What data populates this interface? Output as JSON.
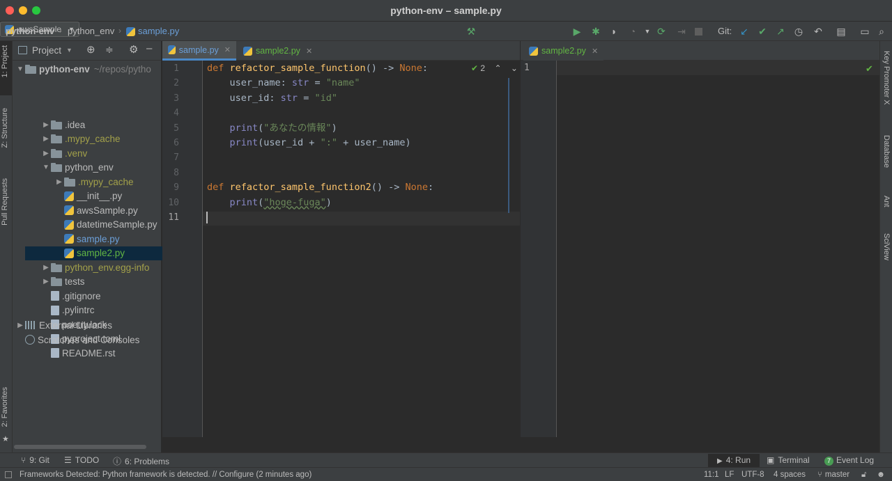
{
  "window": {
    "title": "python-env – sample.py"
  },
  "breadcrumb": [
    "python-env",
    "python_env",
    "sample.py"
  ],
  "toolbar": {
    "run_config": "awsSample",
    "git_label": "Git:"
  },
  "left_tabs": {
    "project": "1: Project",
    "structure": "Z: Structure",
    "pull_requests": "Pull Requests",
    "favorites": "2: Favorites"
  },
  "right_tabs": {
    "key_promoter": "Key Promoter X",
    "database": "Database",
    "ant": "Ant",
    "sciview": "SciView"
  },
  "project_panel": {
    "header": "Project",
    "root": {
      "name": "python-env",
      "path": "~/repos/pytho"
    },
    "items": [
      {
        "label": ".idea",
        "type": "folder",
        "depth": 1,
        "expand": "collapsed",
        "color": "default"
      },
      {
        "label": ".mypy_cache",
        "type": "folder",
        "depth": 1,
        "expand": "collapsed",
        "color": "olive"
      },
      {
        "label": ".venv",
        "type": "folder",
        "depth": 1,
        "expand": "collapsed",
        "color": "olive"
      },
      {
        "label": "python_env",
        "type": "folder",
        "depth": 1,
        "expand": "expanded",
        "color": "default"
      },
      {
        "label": ".mypy_cache",
        "type": "folder",
        "depth": 2,
        "expand": "collapsed",
        "color": "olive"
      },
      {
        "label": "__init__.py",
        "type": "py",
        "depth": 2,
        "expand": "none",
        "color": "default"
      },
      {
        "label": "awsSample.py",
        "type": "py",
        "depth": 2,
        "expand": "none",
        "color": "default"
      },
      {
        "label": "datetimeSample.py",
        "type": "py",
        "depth": 2,
        "expand": "none",
        "color": "default"
      },
      {
        "label": "sample.py",
        "type": "py",
        "depth": 2,
        "expand": "none",
        "color": "blue"
      },
      {
        "label": "sample2.py",
        "type": "py",
        "depth": 2,
        "expand": "none",
        "color": "green",
        "selected": true
      },
      {
        "label": "python_env.egg-info",
        "type": "folder",
        "depth": 1,
        "expand": "collapsed",
        "color": "olive"
      },
      {
        "label": "tests",
        "type": "folder",
        "depth": 1,
        "expand": "collapsed",
        "color": "default"
      },
      {
        "label": ".gitignore",
        "type": "file",
        "depth": 1,
        "expand": "none",
        "color": "default"
      },
      {
        "label": ".pylintrc",
        "type": "file",
        "depth": 1,
        "expand": "none",
        "color": "default"
      },
      {
        "label": "poetry.lock",
        "type": "file",
        "depth": 1,
        "expand": "none",
        "color": "default"
      },
      {
        "label": "pyproject.toml",
        "type": "file",
        "depth": 1,
        "expand": "none",
        "color": "default"
      },
      {
        "label": "README.rst",
        "type": "file",
        "depth": 1,
        "expand": "none",
        "color": "default"
      }
    ],
    "external_libraries": "External Libraries",
    "scratches": "Scratches and Consoles"
  },
  "editor_left": {
    "tabs": [
      {
        "label": "sample.py",
        "active": true
      },
      {
        "label": "sample2.py",
        "active": false
      }
    ],
    "inspection_count": "2",
    "line_numbers": [
      "1",
      "2",
      "3",
      "4",
      "5",
      "6",
      "7",
      "8",
      "9",
      "10",
      "11"
    ],
    "lines": [
      [
        {
          "t": "def ",
          "c": "kw"
        },
        {
          "t": "refactor_sample_function",
          "c": "fn"
        },
        {
          "t": "() -> ",
          "c": ""
        },
        {
          "t": "None",
          "c": "kw"
        },
        {
          "t": ":",
          "c": ""
        }
      ],
      [
        {
          "t": "    user_name: ",
          "c": ""
        },
        {
          "t": "str",
          "c": "bi"
        },
        {
          "t": " = ",
          "c": ""
        },
        {
          "t": "\"name\"",
          "c": "str"
        }
      ],
      [
        {
          "t": "    user_id: ",
          "c": ""
        },
        {
          "t": "str",
          "c": "bi"
        },
        {
          "t": " = ",
          "c": ""
        },
        {
          "t": "\"id\"",
          "c": "str"
        }
      ],
      [],
      [
        {
          "t": "    ",
          "c": ""
        },
        {
          "t": "print",
          "c": "bi"
        },
        {
          "t": "(",
          "c": ""
        },
        {
          "t": "\"あなたの情報\"",
          "c": "str"
        },
        {
          "t": ")",
          "c": ""
        }
      ],
      [
        {
          "t": "    ",
          "c": ""
        },
        {
          "t": "print",
          "c": "bi"
        },
        {
          "t": "(user_id + ",
          "c": ""
        },
        {
          "t": "\":\"",
          "c": "str"
        },
        {
          "t": " + user_name)",
          "c": ""
        }
      ],
      [],
      [],
      [
        {
          "t": "def ",
          "c": "kw"
        },
        {
          "t": "refactor_sample_function2",
          "c": "fn"
        },
        {
          "t": "() -> ",
          "c": ""
        },
        {
          "t": "None",
          "c": "kw"
        },
        {
          "t": ":",
          "c": ""
        }
      ],
      [
        {
          "t": "    ",
          "c": ""
        },
        {
          "t": "print",
          "c": "bi"
        },
        {
          "t": "(",
          "c": ""
        },
        {
          "t": "\"hoge-fuga\"",
          "c": "str"
        },
        {
          "t": ")",
          "c": ""
        }
      ],
      []
    ]
  },
  "editor_right": {
    "tabs": [
      {
        "label": "sample2.py",
        "active": false
      }
    ],
    "line_numbers": [
      "1"
    ]
  },
  "bottom_tools": {
    "git": "9: Git",
    "todo": "TODO",
    "problems": "6: Problems",
    "run": "4: Run",
    "terminal": "Terminal",
    "event_log": "Event Log",
    "event_count": "7"
  },
  "status": {
    "message": "Frameworks Detected: Python framework is detected. // Configure (2 minutes ago)",
    "position": "11:1",
    "line_sep": "LF",
    "encoding": "UTF-8",
    "indent": "4 spaces",
    "branch": "master"
  },
  "colors": {
    "accent": "#4a88c7",
    "run_green": "#59a869",
    "keyword": "#cc7832",
    "function": "#ffc66d",
    "string": "#6a8759"
  }
}
